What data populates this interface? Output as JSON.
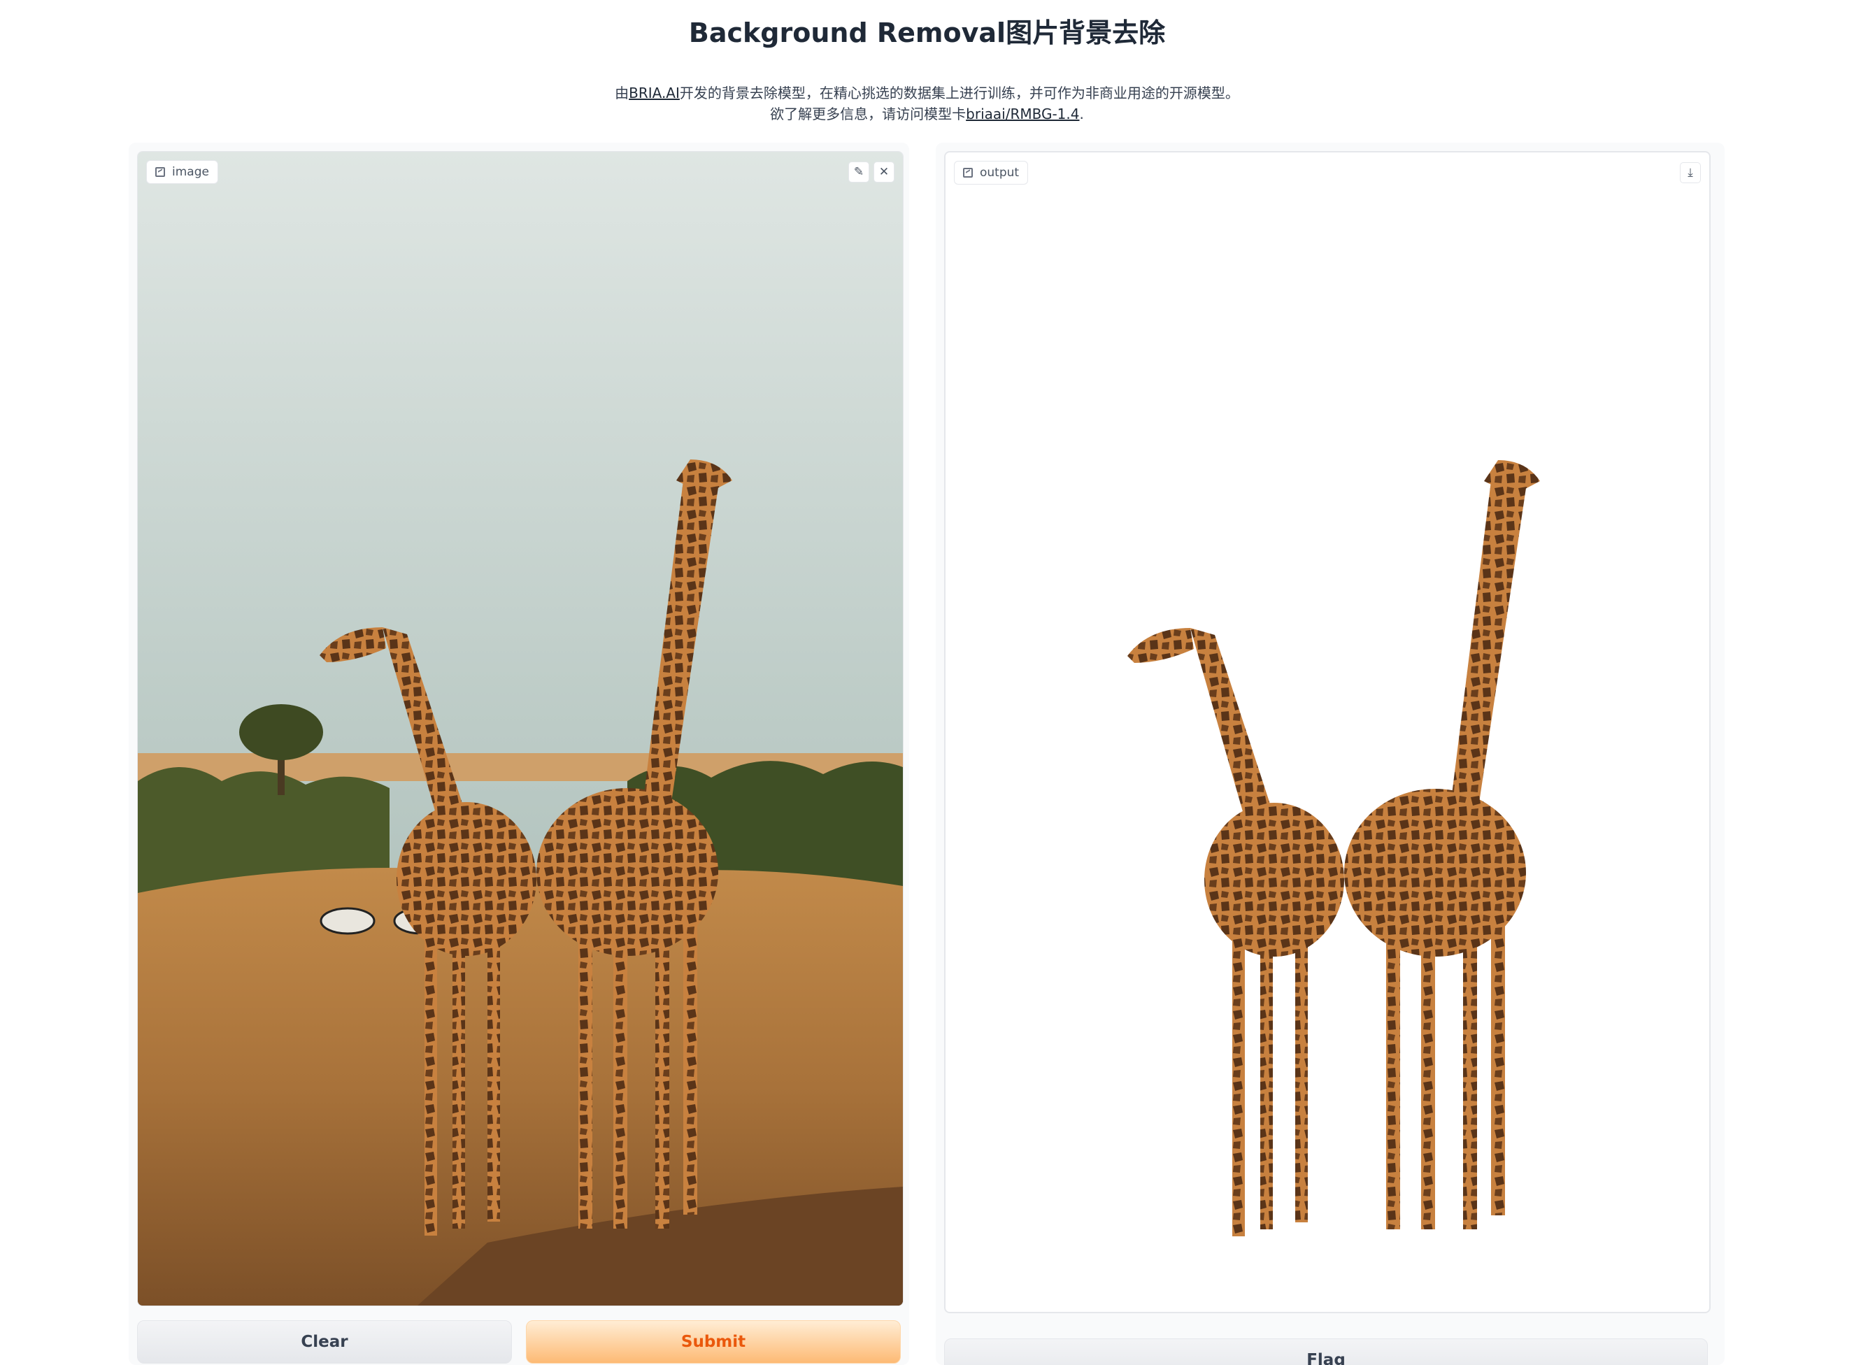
{
  "header": {
    "title": "Background Removal图片背景去除",
    "desc_prefix": "由",
    "desc_link1": "BRIA.AI",
    "desc_mid": "开发的背景去除模型，在精心挑选的数据集上进行训练，并可作为非商业用途的开源模型。",
    "desc_line2_prefix": "欲了解更多信息，请访问模型卡",
    "desc_link2": "briaai/RMBG-1.4",
    "desc_suffix": "."
  },
  "input_panel": {
    "label": "image",
    "icon": "image-icon",
    "edit_icon": "pencil-icon",
    "close_icon": "close-icon",
    "clear_label": "Clear",
    "submit_label": "Submit"
  },
  "output_panel": {
    "label": "output",
    "icon": "image-icon",
    "download_icon": "download-icon",
    "flag_label": "Flag"
  },
  "colors": {
    "submit_text": "#ea580c",
    "submit_bg": "#fdba74",
    "sky": "#c9d6d2",
    "grass": "#b07a3c",
    "giraffe": "#c8813f",
    "spots": "#5a3418"
  }
}
